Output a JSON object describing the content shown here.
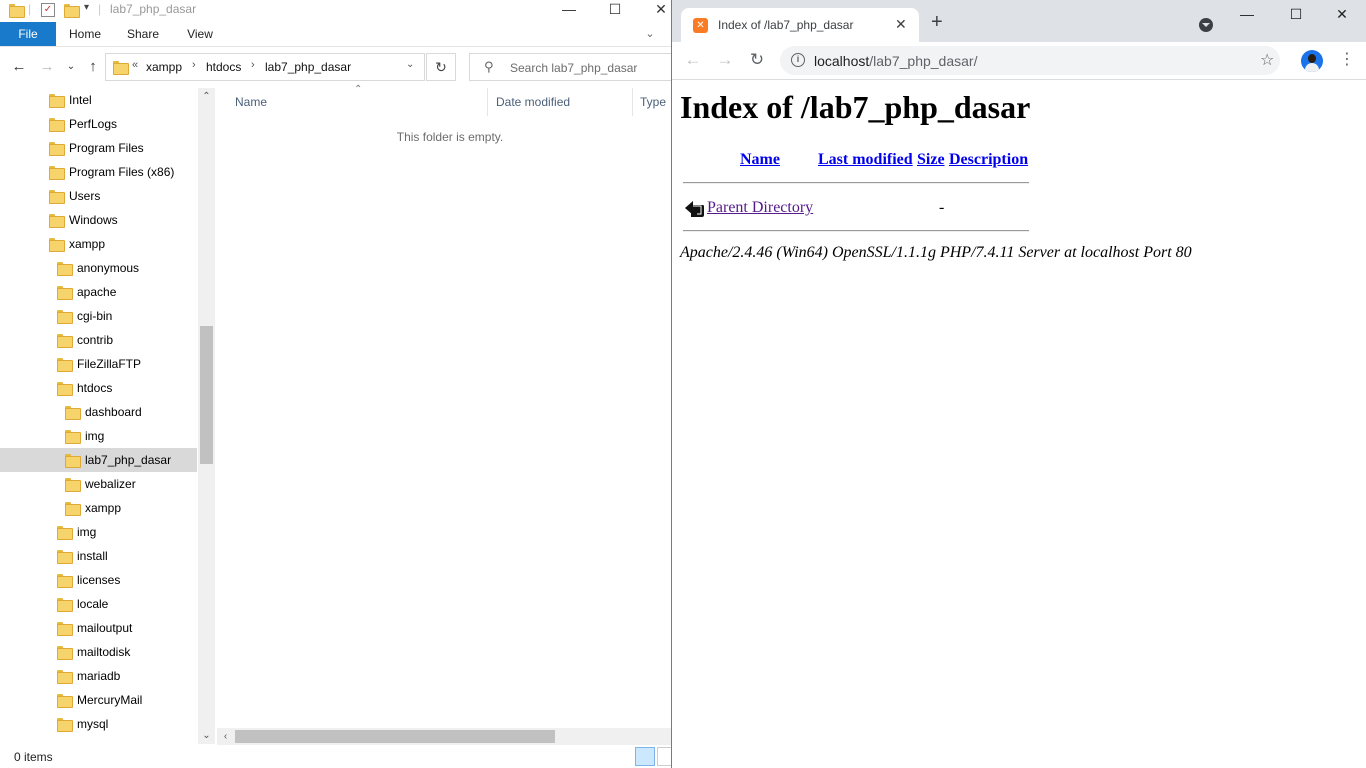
{
  "explorer": {
    "title": "lab7_php_dasar",
    "ribbon_tabs": [
      "File",
      "Home",
      "Share",
      "View"
    ],
    "address": {
      "overflow": "«",
      "crumbs": [
        "xampp",
        "htdocs",
        "lab7_php_dasar"
      ]
    },
    "search_placeholder": "Search lab7_php_dasar",
    "tree": [
      {
        "label": "Intel",
        "level": 1
      },
      {
        "label": "PerfLogs",
        "level": 1
      },
      {
        "label": "Program Files",
        "level": 1
      },
      {
        "label": "Program Files (x86)",
        "level": 1
      },
      {
        "label": "Users",
        "level": 1
      },
      {
        "label": "Windows",
        "level": 1
      },
      {
        "label": "xampp",
        "level": 1
      },
      {
        "label": "anonymous",
        "level": 2
      },
      {
        "label": "apache",
        "level": 2
      },
      {
        "label": "cgi-bin",
        "level": 2
      },
      {
        "label": "contrib",
        "level": 2
      },
      {
        "label": "FileZillaFTP",
        "level": 2
      },
      {
        "label": "htdocs",
        "level": 2
      },
      {
        "label": "dashboard",
        "level": 3
      },
      {
        "label": "img",
        "level": 3
      },
      {
        "label": "lab7_php_dasar",
        "level": 3,
        "selected": true
      },
      {
        "label": "webalizer",
        "level": 3
      },
      {
        "label": "xampp",
        "level": 3
      },
      {
        "label": "img",
        "level": 2
      },
      {
        "label": "install",
        "level": 2
      },
      {
        "label": "licenses",
        "level": 2
      },
      {
        "label": "locale",
        "level": 2
      },
      {
        "label": "mailoutput",
        "level": 2
      },
      {
        "label": "mailtodisk",
        "level": 2
      },
      {
        "label": "mariadb",
        "level": 2
      },
      {
        "label": "MercuryMail",
        "level": 2
      },
      {
        "label": "mysql",
        "level": 2
      }
    ],
    "columns": [
      "Name",
      "Date modified",
      "Type"
    ],
    "empty_message": "This folder is empty.",
    "status": "0 items"
  },
  "chrome": {
    "tab_title": "Index of /lab7_php_dasar",
    "url_host": "localhost",
    "url_path": "/lab7_php_dasar/",
    "page": {
      "heading": "Index of /lab7_php_dasar",
      "columns": {
        "name": "Name",
        "last_modified": "Last modified",
        "size": "Size",
        "description": "Description"
      },
      "parent_link": "Parent Directory",
      "parent_size": "-",
      "server_signature": "Apache/2.4.46 (Win64) OpenSSL/1.1.1g PHP/7.4.11 Server at localhost Port 80"
    }
  },
  "colors": {
    "ribbon_file": "#1979ca",
    "folder": "#f6d36b",
    "link": "#0000ee",
    "visited_link": "#551a8b",
    "xampp_favicon": "#fb7a24"
  }
}
